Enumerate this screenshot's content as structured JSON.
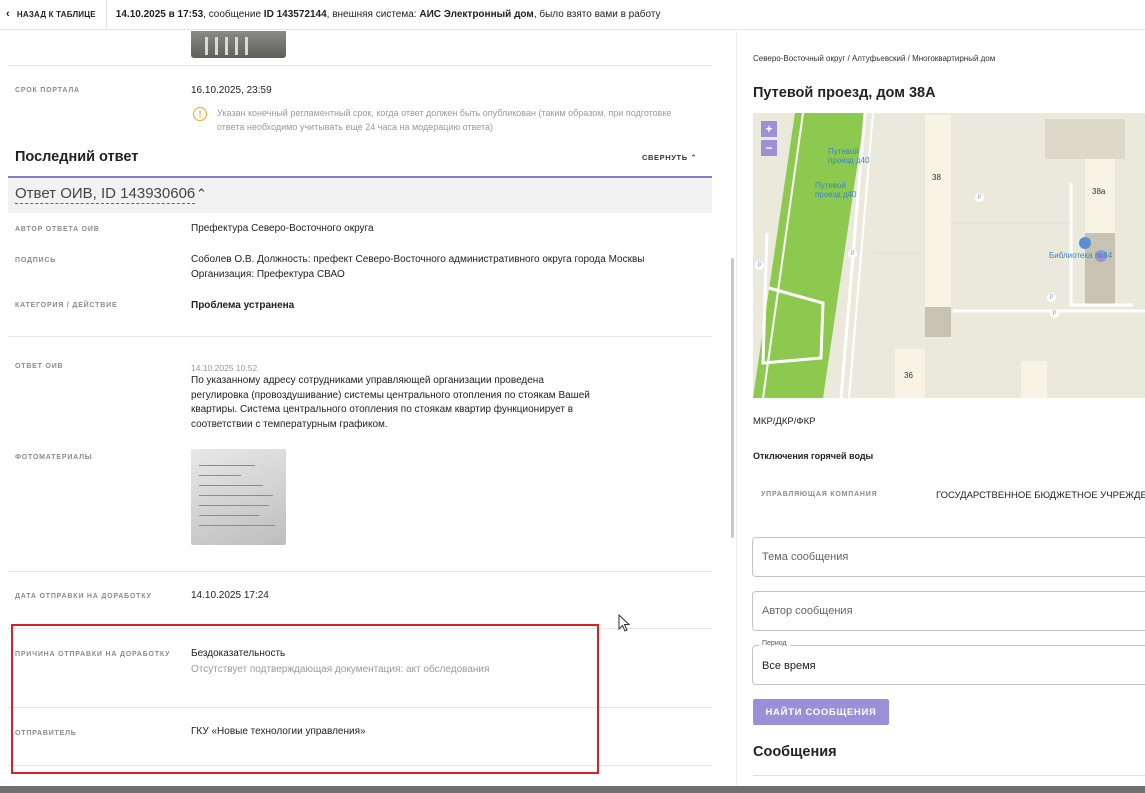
{
  "topbar": {
    "back_label": "НАЗАД К ТАБЛИЦЕ",
    "date": "14.10.2025 в 17:53",
    "text_1": ", сообщение ",
    "message_id": "ID 143572144",
    "text_2": ", внешняя система: ",
    "system": "АИС Электронный дом",
    "text_3": ", было взято вами в работу"
  },
  "left": {
    "portal_deadline": {
      "label": "СРОК ПОРТАЛА",
      "value": "16.10.2025, 23:59",
      "note": "Указан конечный регламентный срок, когда ответ должен быть опубликован (таким образом, при подготовке ответа необходимо учитывать еще 24 часа на модерацию ответа)"
    },
    "last_answer": {
      "title": "Последний ответ",
      "collapse_label": "СВЕРНУТЬ",
      "answer_title": "Ответ ОИВ, ID 143930606"
    },
    "rows": {
      "author": {
        "label": "АВТОР ОТВЕТА ОИВ",
        "value": "Префектура Северо-Восточного округа"
      },
      "signature": {
        "label": "ПОДПИСЬ",
        "value": "Соболев О.В. Должность: префект Северо-Восточного административного округа города Москвы Организация: Префектура СВАО"
      },
      "category": {
        "label": "КАТЕГОРИЯ / ДЕЙСТВИЕ",
        "value": "Проблема устранена"
      },
      "answer": {
        "label": "ОТВЕТ ОИВ",
        "date": "14.10.2025 10:52",
        "text": "По указанному адресу сотрудниками управляющей организации проведена регулировка (провоздушивание) системы центрального отопления по стоякам Вашей квартиры. Система центрального отопления по стоякам квартир функционирует в соответствии с температурным графиком."
      },
      "photos": {
        "label": "ФОТОМАТЕРИАЛЫ"
      },
      "rework_date": {
        "label": "ДАТА ОТПРАВКИ НА ДОРАБОТКУ",
        "value": "14.10.2025 17:24"
      },
      "rework_reason": {
        "label": "ПРИЧИНА ОТПРАВКИ НА ДОРАБОТКУ",
        "value": "Бездоказательность",
        "sub": "Отсутствует подтверждающая документация: акт обследования"
      },
      "sender": {
        "label": "ОТПРАВИТЕЛЬ",
        "value": "ГКУ «Новые технологии управления»"
      }
    }
  },
  "right": {
    "breadcrumb": "Северо-Восточный округ / Алтуфьевский / Многоквартирный дом",
    "address": "Путевой проезд, дом 38А",
    "map": {
      "zoom_in": "+",
      "zoom_out": "−",
      "stop_1": "Путевой проезд д40",
      "stop_2": "Путевой проезд д40",
      "num_38": "38",
      "num_38a": "38а",
      "num_36": "36",
      "library": "Библиотека №64",
      "parking": "P"
    },
    "mkr": "МКР/ДКР/ФКР",
    "hot_water": "Отключения горячей воды",
    "company_label": "УПРАВЛЯЮЩАЯ КОМПАНИЯ",
    "company_value": "ГОСУДАРСТВЕННОЕ БЮДЖЕТНОЕ УЧРЕЖДЕНИЕ",
    "subject_placeholder": "Тема сообщения",
    "author_placeholder": "Автор сообщения",
    "period_label": "Период",
    "period_value": "Все время",
    "search_button": "НАЙТИ СООБЩЕНИЯ",
    "messages_title": "Сообщения"
  },
  "colors": {
    "accent": "#9b8fd8",
    "highlight": "#d3222a",
    "info": "#f0a52a",
    "map_green": "#8dc94f"
  }
}
